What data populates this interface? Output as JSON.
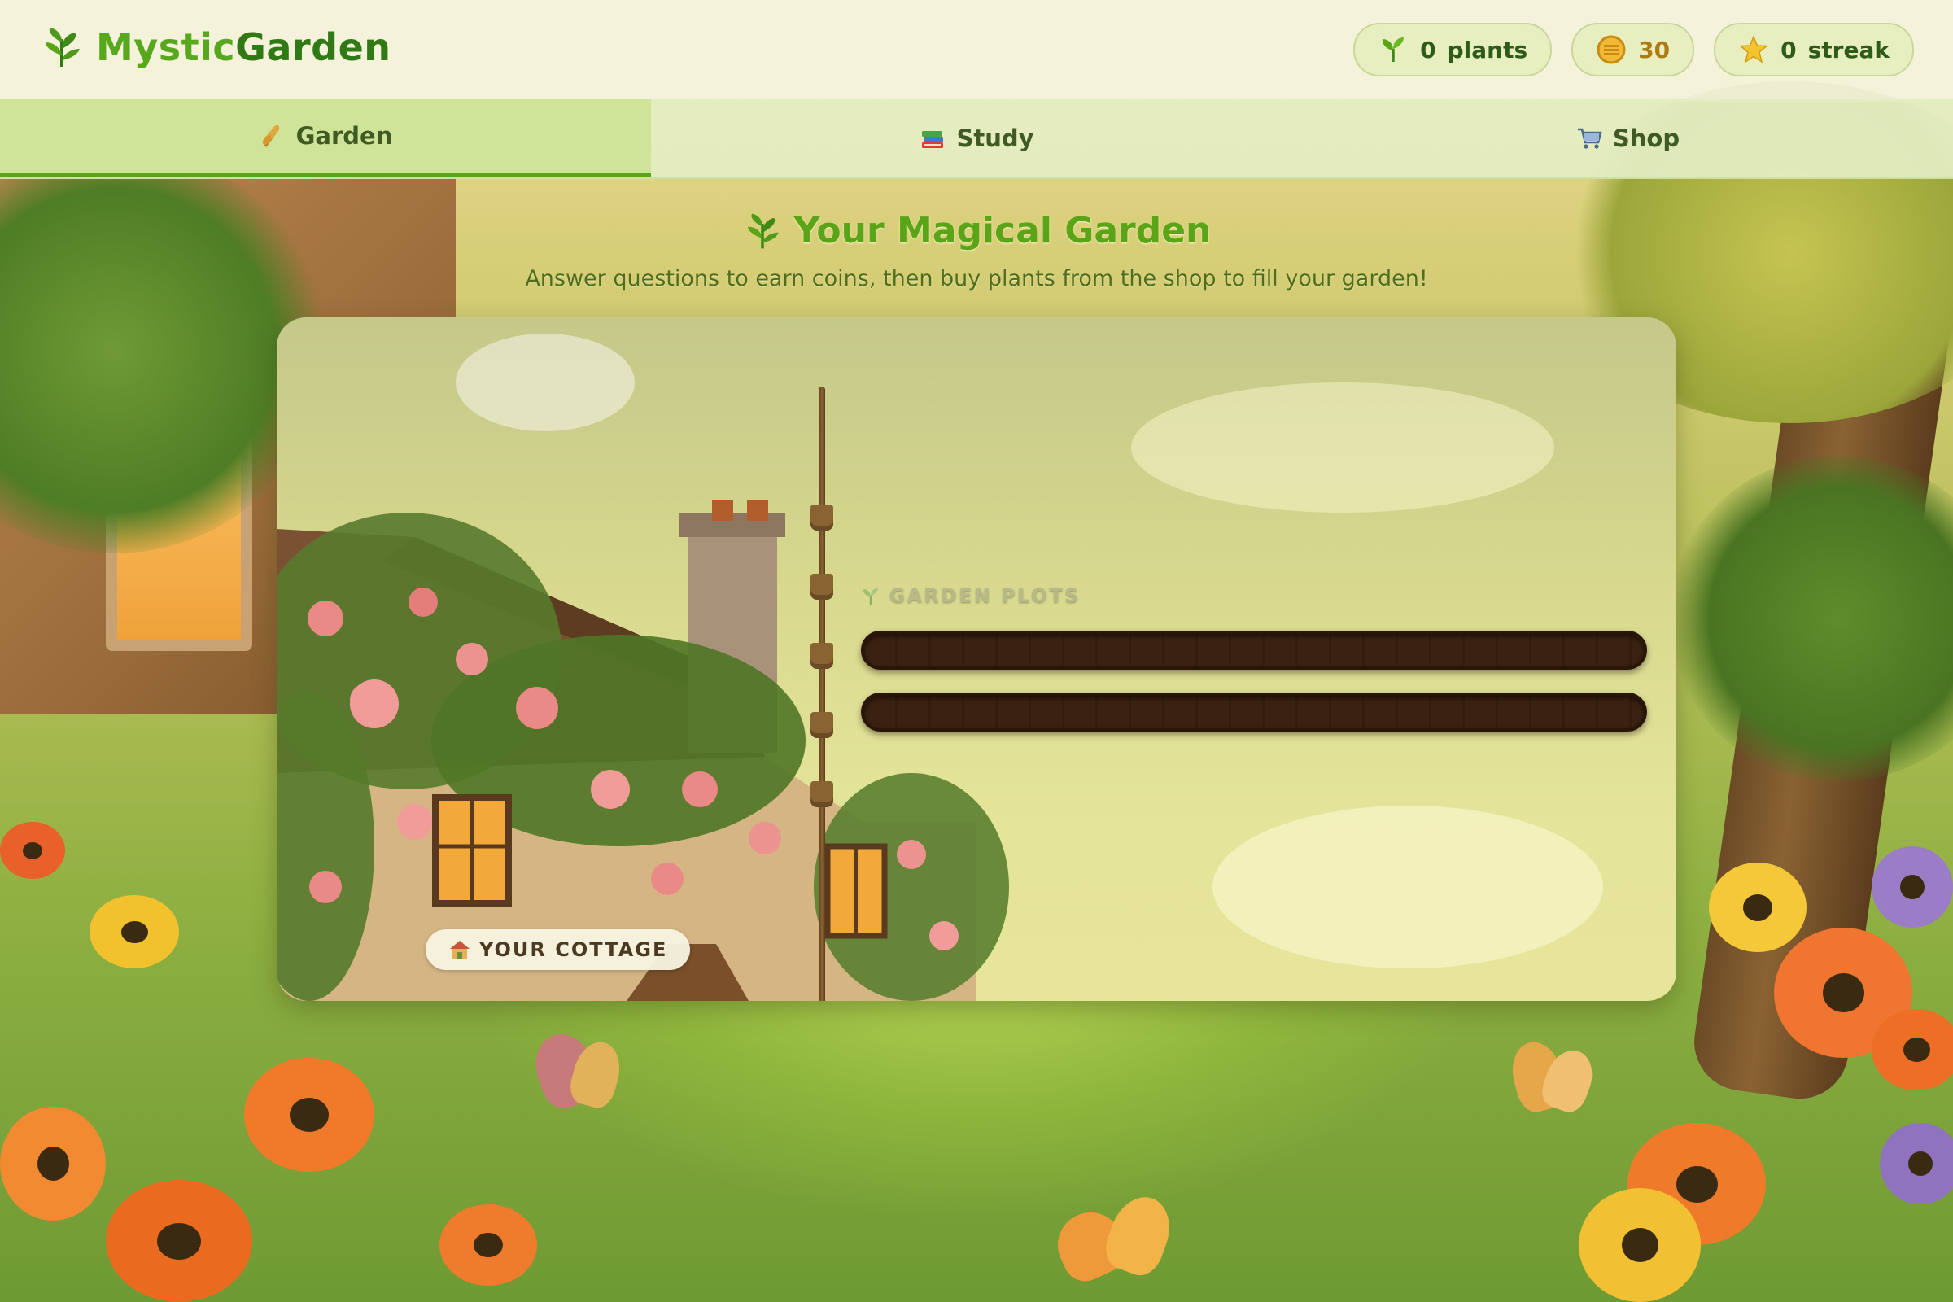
{
  "app": {
    "logo_prefix": "Mystic",
    "logo_suffix": "Garden",
    "logo_icon": "herb-leaf-icon"
  },
  "stats": {
    "plants_value": "0",
    "plants_label": "plants",
    "coins_value": "30",
    "streak_value": "0",
    "streak_label": "streak"
  },
  "tabs": [
    {
      "label": "Garden",
      "icon": "wheat-icon",
      "active": true
    },
    {
      "label": "Study",
      "icon": "books-icon",
      "active": false
    },
    {
      "label": "Shop",
      "icon": "cart-icon",
      "active": false
    }
  ],
  "main": {
    "title": "Your Magical Garden",
    "subtitle": "Answer questions to earn coins, then buy plants from the shop to fill your garden!",
    "plots_label": "GARDEN PLOTS",
    "cottage_label": "YOUR COTTAGE"
  },
  "colors": {
    "brand_dark": "#2f7a14",
    "brand_light": "#58a81e",
    "active_tab_underline": "#5aa517",
    "coin": "#b07a10",
    "soil": "#3b2210"
  }
}
